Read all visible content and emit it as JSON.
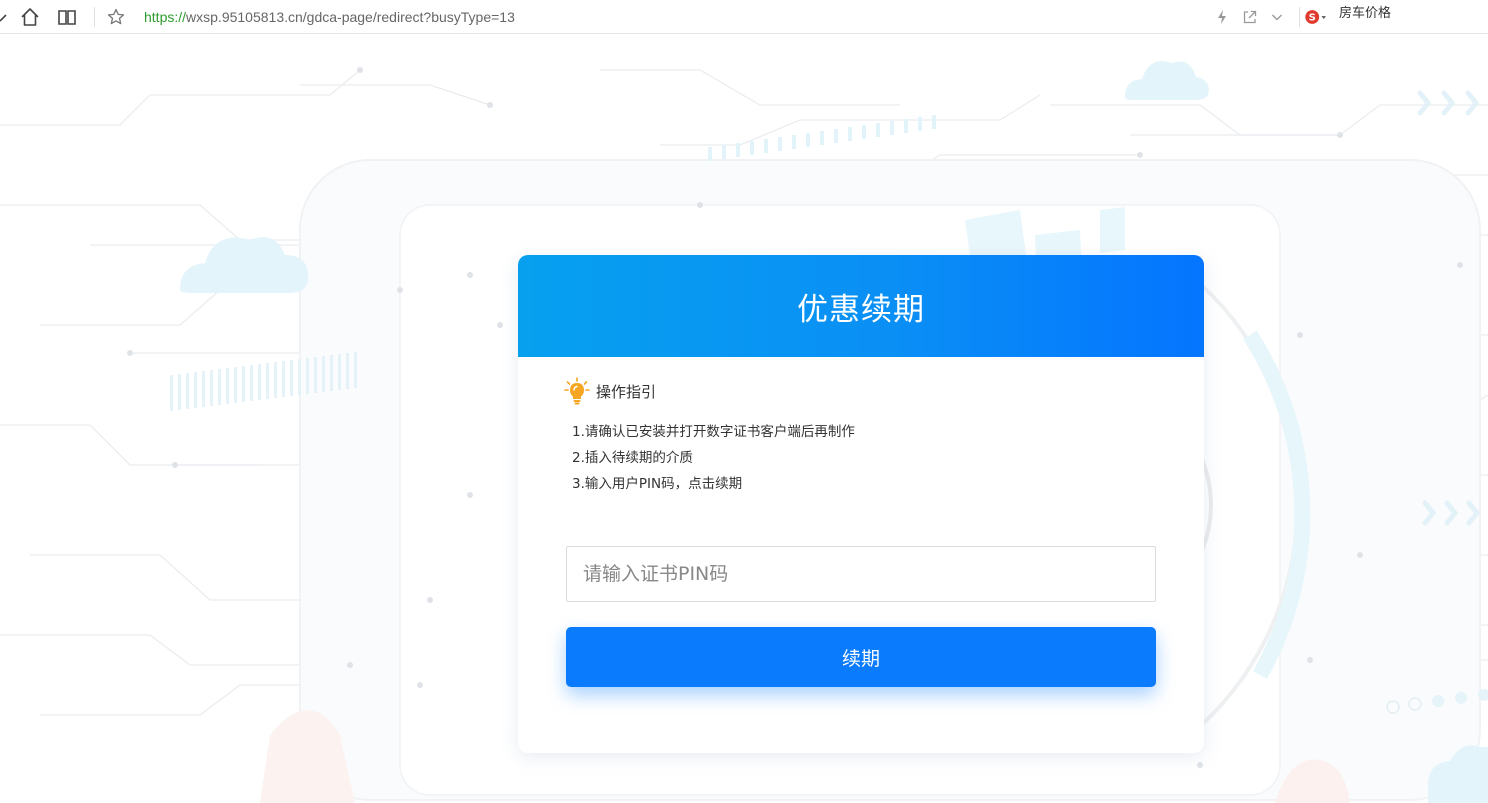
{
  "browser": {
    "url_scheme": "https://",
    "url_rest": "wxsp.95105813.cn/gdca-page/redirect?busyType=13",
    "extension_text": "房车价格",
    "icons": [
      "home-icon",
      "reader-icon",
      "star-icon",
      "lightning-icon",
      "share-icon",
      "chevron-down-icon",
      "sogou-icon"
    ]
  },
  "card": {
    "title": "优惠续期",
    "guide_title": "操作指引",
    "steps": [
      "1.请确认已安装并打开数字证书客户端后再制作",
      "2.插入待续期的介质",
      "3.输入用户PIN码，点击续期"
    ],
    "pin_placeholder": "请输入证书PIN码",
    "renew_button": "续期"
  },
  "colors": {
    "header_gradient_start": "#06a0ef",
    "header_gradient_end": "#0475ff",
    "button": "#0a7bfc",
    "url_scheme": "#2e9c2e"
  }
}
